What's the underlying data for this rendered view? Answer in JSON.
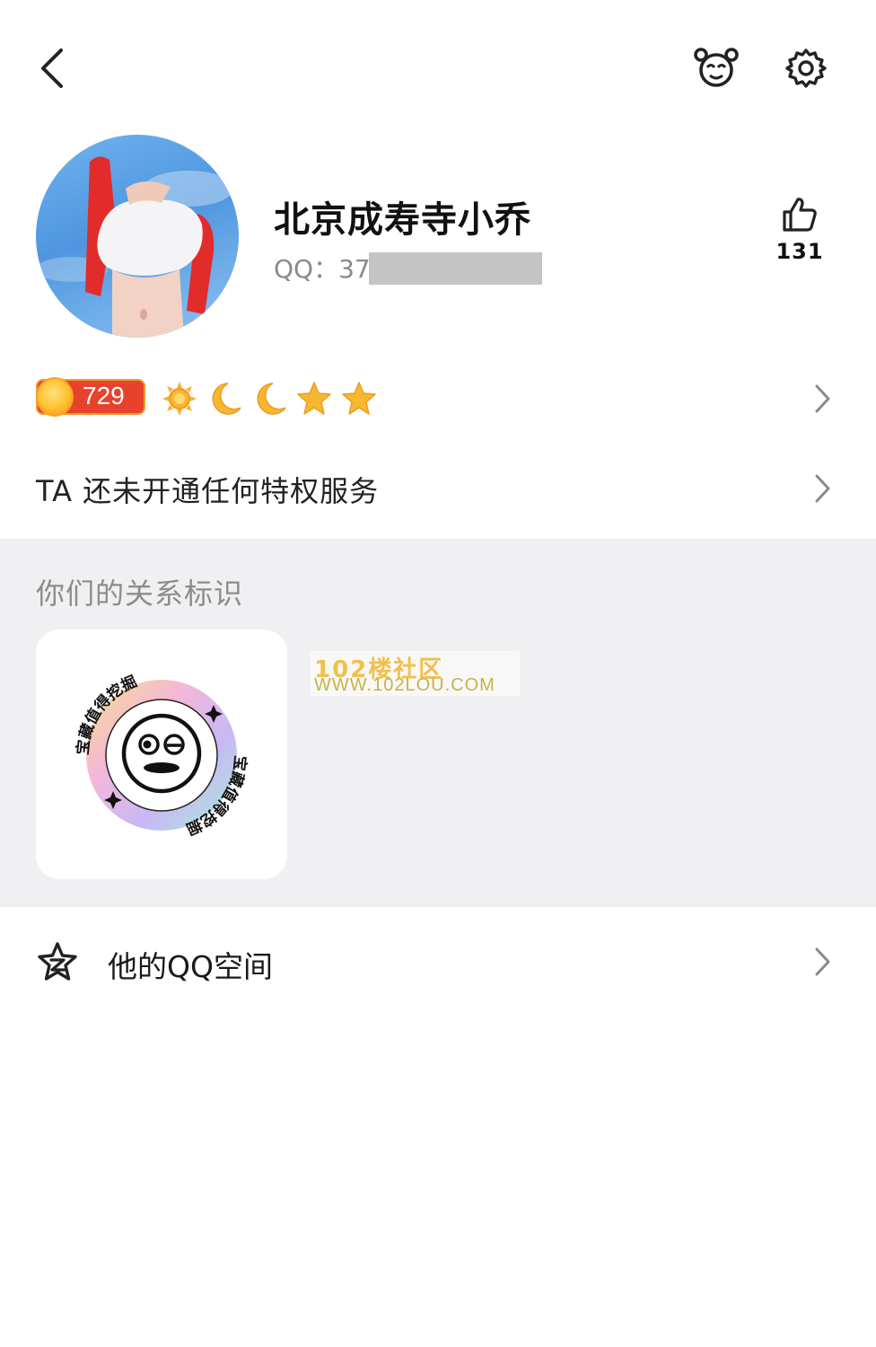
{
  "header": {
    "back_icon": "chevron-left-icon",
    "friend_avatar_icon": "bear-face-icon",
    "settings_icon": "gear-icon"
  },
  "profile": {
    "nickname": "北京成寿寺小乔",
    "qq_label": "QQ：37",
    "likes": "131"
  },
  "level": {
    "number": "729",
    "icons": [
      "sun-icon",
      "moon-icon",
      "moon-icon",
      "star-icon",
      "star-icon"
    ]
  },
  "privilege": {
    "text": "TA 还未开通任何特权服务"
  },
  "relation": {
    "title": "你们的关系标识",
    "badge_text": "宝藏值得挖掘",
    "watermark_line1": "102楼社区",
    "watermark_line2": "WWW.102LOU.COM"
  },
  "qzone": {
    "label": "他的QQ空间"
  },
  "colors": {
    "level_badge": "#e8422c",
    "section_bg": "#f0f0f2",
    "gold": "#f7b731"
  }
}
